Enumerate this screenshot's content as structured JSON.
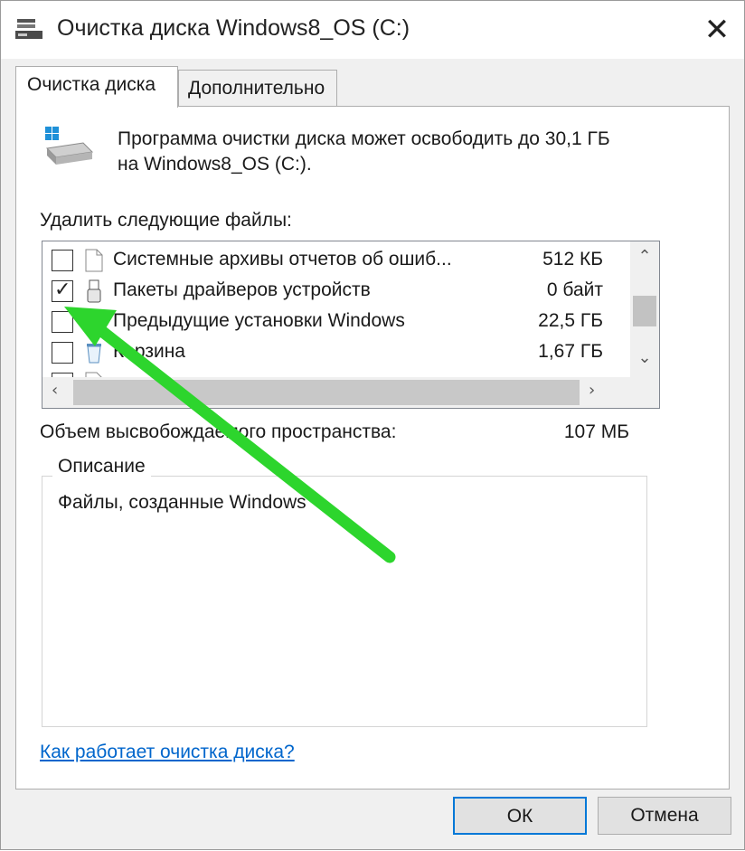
{
  "window": {
    "title": "Очистка диска Windows8_OS (C:)",
    "close_glyph": "✕"
  },
  "tabs": [
    {
      "label": "Очистка диска",
      "active": true
    },
    {
      "label": "Дополнительно",
      "active": false
    }
  ],
  "intro": {
    "line1": "Программа очистки диска может освободить до 30,1 ГБ",
    "line2": "на Windows8_OS (C:)."
  },
  "files_label": "Удалить следующие файлы:",
  "files": [
    {
      "name": "Системные архивы отчетов об ошиб...",
      "size": "512 КБ",
      "checked": false,
      "icon": "file-icon"
    },
    {
      "name": "Пакеты драйверов устройств",
      "size": "0 байт",
      "checked": true,
      "icon": "usb-driver-icon"
    },
    {
      "name": "Предыдущие установки Windows",
      "size": "22,5 ГБ",
      "checked": false,
      "icon": "windows-icon"
    },
    {
      "name": "Корзина",
      "size": "1,67 ГБ",
      "checked": false,
      "icon": "recycle-bin-icon"
    },
    {
      "name": "",
      "size": "",
      "checked": false,
      "icon": "file-icon"
    }
  ],
  "space": {
    "label": "Объем высвобождаемого пространства:",
    "value": "107 МБ"
  },
  "description": {
    "title": "Описание",
    "text": "Файлы, созданные Windows"
  },
  "help_link": "Как работает очистка диска?",
  "buttons": {
    "ok": "ОК",
    "cancel": "Отмена"
  },
  "colors": {
    "annotation_arrow": "#2dd52d",
    "link": "#0066cc",
    "accent": "#0078d7"
  }
}
